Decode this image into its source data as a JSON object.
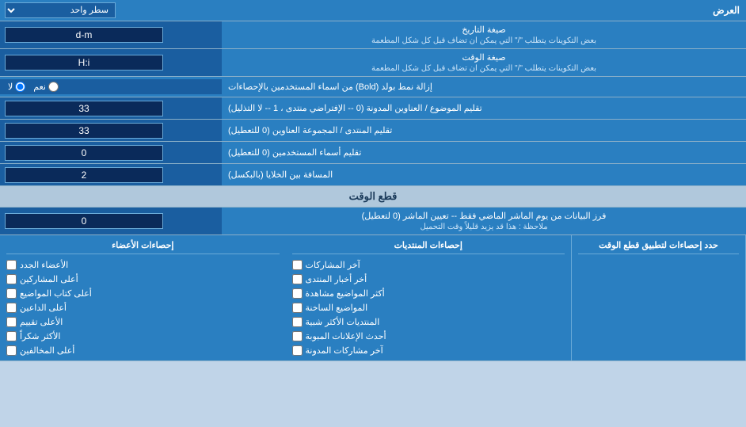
{
  "header": {
    "display_label": "العرض",
    "display_option": "سطر واحد"
  },
  "rows": [
    {
      "id": "date_format",
      "label": "صيغة التاريخ",
      "sub_label": "بعض التكوينات يتطلب \"/\" التي يمكن ان تضاف قبل كل شكل المطعمة",
      "value": "d-m"
    },
    {
      "id": "time_format",
      "label": "صيغة الوقت",
      "sub_label": "بعض التكوينات يتطلب \"/\" التي يمكن ان تضاف قبل كل شكل المطعمة",
      "value": "H:i"
    },
    {
      "id": "remove_bold",
      "label": "إزالة نمط بولد (Bold) من اسماء المستخدمين بالإحصاءات",
      "radio_yes": "نعم",
      "radio_no": "لا",
      "selected": "no"
    },
    {
      "id": "subject_title",
      "label": "تقليم الموضوع / العناوين المدونة (0 -- الإفتراضي منتدى ، 1 -- لا التذليل)",
      "value": "33"
    },
    {
      "id": "forum_header",
      "label": "تقليم المنتدى / المجموعة العناوين (0 للتعطيل)",
      "value": "33"
    },
    {
      "id": "username_trim",
      "label": "تقليم أسماء المستخدمين (0 للتعطيل)",
      "value": "0"
    },
    {
      "id": "cell_spacing",
      "label": "المسافة بين الخلايا (بالبكسل)",
      "value": "2"
    }
  ],
  "section_cut_time": {
    "header": "قطع الوقت",
    "row": {
      "label": "فرز البيانات من يوم الماشر الماضي فقط -- تعيين الماشر (0 لتعطيل)",
      "note": "ملاحظة : هذا قد يزيد قليلاً وقت التحميل",
      "value": "0"
    }
  },
  "checkboxes_section": {
    "label": "حدد إحصاءات لتطبيق قطع الوقت",
    "col1_header": "إحصاءات الأعضاء",
    "col1_items": [
      "الأعضاء الجدد",
      "أعلى المشاركين",
      "أعلى كتاب المواضيع",
      "أعلى الداعين",
      "الأعلى تقييم",
      "الأكثر شكراً",
      "أعلى المخالفين"
    ],
    "col2_header": "إحصاءات المنتديات",
    "col2_items": [
      "آخر المشاركات",
      "أخر أخبار المنتدى",
      "أكثر المواضيع مشاهدة",
      "المواضيع الساخنة",
      "المنتديات الأكثر شبية",
      "أحدث الإعلانات المبوبة",
      "آخر مشاركات المدونة"
    ]
  }
}
